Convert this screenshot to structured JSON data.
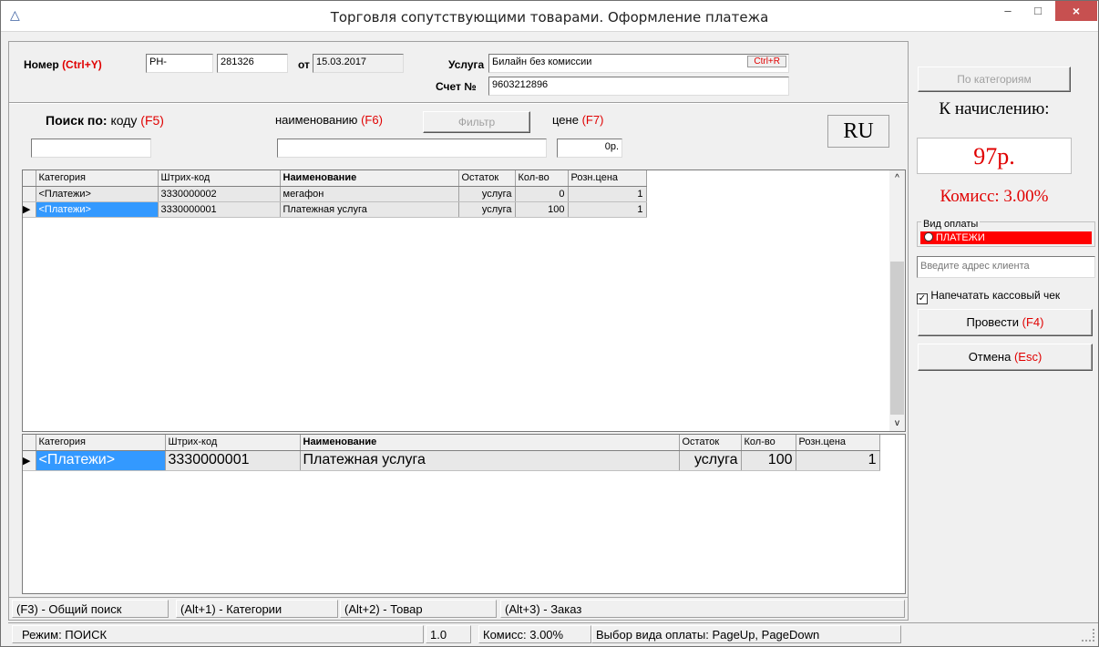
{
  "window": {
    "title": "Торговля сопутствующими товарами. Оформление платежа",
    "minimize": "–",
    "maximize": "□",
    "close": "×"
  },
  "header": {
    "number_label": "Номер",
    "number_hotkey": "(Ctrl+Y)",
    "number_prefix": "PH-",
    "number_value": "281326",
    "date_label": "от",
    "date_value": "15.03.2017",
    "service_label": "Услуга",
    "service_value": "Билайн без комиссии",
    "service_hotkey": "Ctrl+R",
    "account_label": "Счет №",
    "account_value": "9603212896"
  },
  "search": {
    "label": "Поиск по:",
    "by_code": "коду",
    "by_code_key": "(F5)",
    "by_name": "наименованию",
    "by_name_key": "(F6)",
    "filter_button": "Фильтр",
    "by_price": "цене",
    "by_price_key": "(F7)",
    "code_value": "",
    "name_value": "",
    "price_value": "0р.",
    "lang": "RU"
  },
  "grid_top": {
    "columns": [
      "Категория",
      "Штрих-код",
      "Наименование",
      "Остаток",
      "Кол-во",
      "Розн.цена"
    ],
    "rows": [
      [
        "<Платежи>",
        "3330000002",
        "мегафон",
        "услуга",
        "0",
        "1"
      ],
      [
        "<Платежи>",
        "3330000001",
        "Платежная услуга",
        "услуга",
        "100",
        "1"
      ]
    ],
    "scroll_up": "^",
    "scroll_down": "v"
  },
  "grid_bottom": {
    "columns": [
      "Категория",
      "Штрих-код",
      "Наименование",
      "Остаток",
      "Кол-во",
      "Розн.цена"
    ],
    "rows": [
      [
        "<Платежи>",
        "3330000001",
        "Платежная услуга",
        "услуга",
        "100",
        "1"
      ]
    ]
  },
  "hotkeys": {
    "general_search": "(F3) - Общий поиск",
    "categories": "(Alt+1) - Категории",
    "goods": "(Alt+2) - Товар",
    "order": "(Alt+3) - Заказ"
  },
  "statusbar": {
    "mode": "Режим: ПОИСК",
    "version": "1.0",
    "commission": "Комисс: 3.00%",
    "hint": "Выбор вида оплаты: PageUp, PageDown"
  },
  "side": {
    "by_category_button": "По категориям",
    "to_charge_label": "К начислению:",
    "amount": "97р.",
    "commission": "Комисс: 3.00%",
    "payment_type_label": "Вид оплаты",
    "payment_option": "ПЛАТЕЖИ",
    "address_placeholder": "Введите адрес клиента",
    "print_receipt_label": "Напечатать кассовый чек",
    "print_receipt_checked": "true",
    "post_button": "Провести",
    "post_key": "(F4)",
    "cancel_button": "Отмена",
    "cancel_key": "(Esc)"
  },
  "colors": {
    "accent_red": "#e00000",
    "selection_blue": "#3399ff",
    "close_button": "#c75050"
  }
}
